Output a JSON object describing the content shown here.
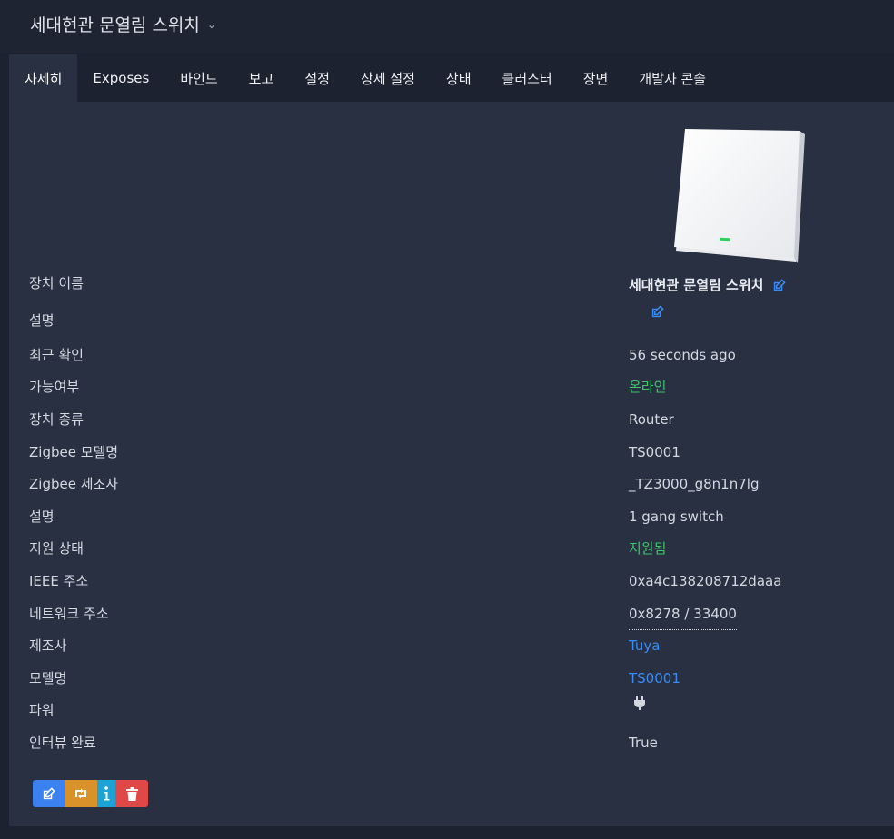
{
  "header": {
    "title": "세대현관 문열림 스위치"
  },
  "tabs": [
    {
      "label": "자세히",
      "active": true
    },
    {
      "label": "Exposes"
    },
    {
      "label": "바인드"
    },
    {
      "label": "보고"
    },
    {
      "label": "설정"
    },
    {
      "label": "상세 설정"
    },
    {
      "label": "상태"
    },
    {
      "label": "클러스터"
    },
    {
      "label": "장면"
    },
    {
      "label": "개발자 콘솔"
    }
  ],
  "details": {
    "device_name": {
      "label": "장치 이름",
      "value": "세대현관 문열림 스위치"
    },
    "description": {
      "label": "설명",
      "value": ""
    },
    "last_seen": {
      "label": "최근 확인",
      "value": "56 seconds ago"
    },
    "availability": {
      "label": "가능여부",
      "value": "온라인"
    },
    "device_type": {
      "label": "장치 종류",
      "value": "Router"
    },
    "zigbee_model": {
      "label": "Zigbee 모델명",
      "value": "TS0001"
    },
    "zigbee_manufacturer": {
      "label": "Zigbee 제조사",
      "value": "_TZ3000_g8n1n7lg"
    },
    "model_description": {
      "label": "설명",
      "value": "1 gang switch"
    },
    "support_status": {
      "label": "지원 상태",
      "value": "지원됨"
    },
    "ieee_address": {
      "label": "IEEE 주소",
      "value": "0xa4c138208712daaa"
    },
    "network_address": {
      "label": "네트워크 주소",
      "value": "0x8278 / 33400"
    },
    "manufacturer": {
      "label": "제조사",
      "value": "Tuya"
    },
    "model": {
      "label": "모델명",
      "value": "TS0001"
    },
    "power": {
      "label": "파워",
      "icon": "plug-icon"
    },
    "interview_completed": {
      "label": "인터뷰 완료",
      "value": "True"
    }
  },
  "colors": {
    "online": "#3ec66b",
    "link": "#3b8cf2",
    "edit_button": "#3b82f0",
    "reconfigure_button": "#d9912a",
    "info_button": "#1aa3d4",
    "delete_button": "#e04848"
  }
}
